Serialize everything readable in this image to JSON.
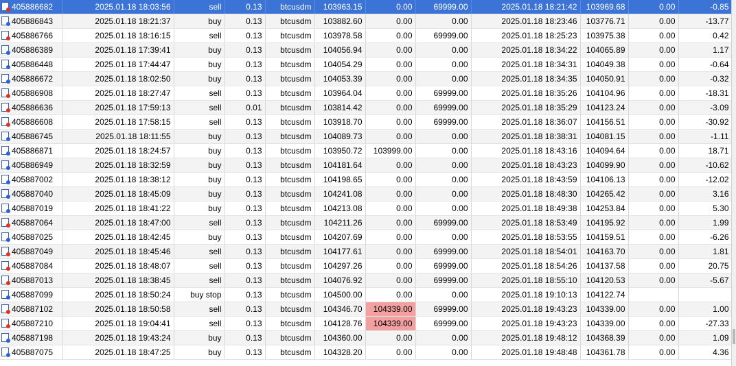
{
  "orders": [
    {
      "ticket": "405886682",
      "open_time": "2025.01.18 18:03:56",
      "type": "sell",
      "volume": "0.13",
      "symbol": "btcusdm",
      "price": "103963.15",
      "sl": "0.00",
      "tp": "69999.00",
      "close_time": "2025.01.18 18:21:42",
      "close_price": "103969.68",
      "swap": "0.00",
      "profit": "-0.85",
      "selected": true
    },
    {
      "ticket": "405886843",
      "open_time": "2025.01.18 18:21:37",
      "type": "buy",
      "volume": "0.13",
      "symbol": "btcusdm",
      "price": "103882.60",
      "sl": "0.00",
      "tp": "0.00",
      "close_time": "2025.01.18 18:23:46",
      "close_price": "103776.71",
      "swap": "0.00",
      "profit": "-13.77"
    },
    {
      "ticket": "405886766",
      "open_time": "2025.01.18 18:16:15",
      "type": "sell",
      "volume": "0.13",
      "symbol": "btcusdm",
      "price": "103978.58",
      "sl": "0.00",
      "tp": "69999.00",
      "close_time": "2025.01.18 18:25:23",
      "close_price": "103975.38",
      "swap": "0.00",
      "profit": "0.42"
    },
    {
      "ticket": "405886389",
      "open_time": "2025.01.18 17:39:41",
      "type": "buy",
      "volume": "0.13",
      "symbol": "btcusdm",
      "price": "104056.94",
      "sl": "0.00",
      "tp": "0.00",
      "close_time": "2025.01.18 18:34:22",
      "close_price": "104065.89",
      "swap": "0.00",
      "profit": "1.17"
    },
    {
      "ticket": "405886448",
      "open_time": "2025.01.18 17:44:47",
      "type": "buy",
      "volume": "0.13",
      "symbol": "btcusdm",
      "price": "104054.29",
      "sl": "0.00",
      "tp": "0.00",
      "close_time": "2025.01.18 18:34:31",
      "close_price": "104049.38",
      "swap": "0.00",
      "profit": "-0.64"
    },
    {
      "ticket": "405886672",
      "open_time": "2025.01.18 18:02:50",
      "type": "buy",
      "volume": "0.13",
      "symbol": "btcusdm",
      "price": "104053.39",
      "sl": "0.00",
      "tp": "0.00",
      "close_time": "2025.01.18 18:34:35",
      "close_price": "104050.91",
      "swap": "0.00",
      "profit": "-0.32"
    },
    {
      "ticket": "405886908",
      "open_time": "2025.01.18 18:27:47",
      "type": "sell",
      "volume": "0.13",
      "symbol": "btcusdm",
      "price": "103964.04",
      "sl": "0.00",
      "tp": "69999.00",
      "close_time": "2025.01.18 18:35:26",
      "close_price": "104104.96",
      "swap": "0.00",
      "profit": "-18.31"
    },
    {
      "ticket": "405886636",
      "open_time": "2025.01.18 17:59:13",
      "type": "sell",
      "volume": "0.01",
      "symbol": "btcusdm",
      "price": "103814.42",
      "sl": "0.00",
      "tp": "69999.00",
      "close_time": "2025.01.18 18:35:29",
      "close_price": "104123.24",
      "swap": "0.00",
      "profit": "-3.09"
    },
    {
      "ticket": "405886608",
      "open_time": "2025.01.18 17:58:15",
      "type": "sell",
      "volume": "0.13",
      "symbol": "btcusdm",
      "price": "103918.70",
      "sl": "0.00",
      "tp": "69999.00",
      "close_time": "2025.01.18 18:36:07",
      "close_price": "104156.51",
      "swap": "0.00",
      "profit": "-30.92"
    },
    {
      "ticket": "405886745",
      "open_time": "2025.01.18 18:11:55",
      "type": "buy",
      "volume": "0.13",
      "symbol": "btcusdm",
      "price": "104089.73",
      "sl": "0.00",
      "tp": "0.00",
      "close_time": "2025.01.18 18:38:31",
      "close_price": "104081.15",
      "swap": "0.00",
      "profit": "-1.11"
    },
    {
      "ticket": "405886871",
      "open_time": "2025.01.18 18:24:57",
      "type": "buy",
      "volume": "0.13",
      "symbol": "btcusdm",
      "price": "103950.72",
      "sl": "103999.00",
      "tp": "0.00",
      "close_time": "2025.01.18 18:43:16",
      "close_price": "104094.64",
      "swap": "0.00",
      "profit": "18.71"
    },
    {
      "ticket": "405886949",
      "open_time": "2025.01.18 18:32:59",
      "type": "buy",
      "volume": "0.13",
      "symbol": "btcusdm",
      "price": "104181.64",
      "sl": "0.00",
      "tp": "0.00",
      "close_time": "2025.01.18 18:43:23",
      "close_price": "104099.90",
      "swap": "0.00",
      "profit": "-10.62"
    },
    {
      "ticket": "405887002",
      "open_time": "2025.01.18 18:38:12",
      "type": "buy",
      "volume": "0.13",
      "symbol": "btcusdm",
      "price": "104198.65",
      "sl": "0.00",
      "tp": "0.00",
      "close_time": "2025.01.18 18:43:59",
      "close_price": "104106.13",
      "swap": "0.00",
      "profit": "-12.02"
    },
    {
      "ticket": "405887040",
      "open_time": "2025.01.18 18:45:09",
      "type": "buy",
      "volume": "0.13",
      "symbol": "btcusdm",
      "price": "104241.08",
      "sl": "0.00",
      "tp": "0.00",
      "close_time": "2025.01.18 18:48:30",
      "close_price": "104265.42",
      "swap": "0.00",
      "profit": "3.16"
    },
    {
      "ticket": "405887019",
      "open_time": "2025.01.18 18:41:22",
      "type": "buy",
      "volume": "0.13",
      "symbol": "btcusdm",
      "price": "104213.08",
      "sl": "0.00",
      "tp": "0.00",
      "close_time": "2025.01.18 18:49:38",
      "close_price": "104253.84",
      "swap": "0.00",
      "profit": "5.30"
    },
    {
      "ticket": "405887064",
      "open_time": "2025.01.18 18:47:00",
      "type": "sell",
      "volume": "0.13",
      "symbol": "btcusdm",
      "price": "104211.26",
      "sl": "0.00",
      "tp": "69999.00",
      "close_time": "2025.01.18 18:53:49",
      "close_price": "104195.92",
      "swap": "0.00",
      "profit": "1.99"
    },
    {
      "ticket": "405887025",
      "open_time": "2025.01.18 18:42:45",
      "type": "buy",
      "volume": "0.13",
      "symbol": "btcusdm",
      "price": "104207.69",
      "sl": "0.00",
      "tp": "0.00",
      "close_time": "2025.01.18 18:53:55",
      "close_price": "104159.51",
      "swap": "0.00",
      "profit": "-6.26"
    },
    {
      "ticket": "405887049",
      "open_time": "2025.01.18 18:45:46",
      "type": "sell",
      "volume": "0.13",
      "symbol": "btcusdm",
      "price": "104177.61",
      "sl": "0.00",
      "tp": "69999.00",
      "close_time": "2025.01.18 18:54:01",
      "close_price": "104163.70",
      "swap": "0.00",
      "profit": "1.81"
    },
    {
      "ticket": "405887084",
      "open_time": "2025.01.18 18:48:07",
      "type": "sell",
      "volume": "0.13",
      "symbol": "btcusdm",
      "price": "104297.26",
      "sl": "0.00",
      "tp": "69999.00",
      "close_time": "2025.01.18 18:54:26",
      "close_price": "104137.58",
      "swap": "0.00",
      "profit": "20.75"
    },
    {
      "ticket": "405887013",
      "open_time": "2025.01.18 18:38:45",
      "type": "sell",
      "volume": "0.13",
      "symbol": "btcusdm",
      "price": "104076.92",
      "sl": "0.00",
      "tp": "69999.00",
      "close_time": "2025.01.18 18:55:10",
      "close_price": "104120.53",
      "swap": "0.00",
      "profit": "-5.67"
    },
    {
      "ticket": "405887099",
      "open_time": "2025.01.18 18:50:24",
      "type": "buy stop",
      "volume": "0.13",
      "symbol": "btcusdm",
      "price": "104500.00",
      "sl": "0.00",
      "tp": "0.00",
      "close_time": "2025.01.18 19:10:13",
      "close_price": "104122.74",
      "swap": "",
      "profit": ""
    },
    {
      "ticket": "405887102",
      "open_time": "2025.01.18 18:50:58",
      "type": "sell",
      "volume": "0.13",
      "symbol": "btcusdm",
      "price": "104346.70",
      "sl": "104339.00",
      "tp": "69999.00",
      "close_time": "2025.01.18 19:43:23",
      "close_price": "104339.00",
      "swap": "0.00",
      "profit": "1.00",
      "sl_highlight": true
    },
    {
      "ticket": "405887210",
      "open_time": "2025.01.18 19:04:41",
      "type": "sell",
      "volume": "0.13",
      "symbol": "btcusdm",
      "price": "104128.76",
      "sl": "104339.00",
      "tp": "69999.00",
      "close_time": "2025.01.18 19:43:23",
      "close_price": "104339.00",
      "swap": "0.00",
      "profit": "-27.33",
      "sl_highlight": true
    },
    {
      "ticket": "405887198",
      "open_time": "2025.01.18 19:43:24",
      "type": "buy",
      "volume": "0.13",
      "symbol": "btcusdm",
      "price": "104360.00",
      "sl": "0.00",
      "tp": "0.00",
      "close_time": "2025.01.18 19:48:12",
      "close_price": "104368.39",
      "swap": "0.00",
      "profit": "1.09"
    },
    {
      "ticket": "405887075",
      "open_time": "2025.01.18 18:47:25",
      "type": "buy",
      "volume": "0.13",
      "symbol": "btcusdm",
      "price": "104328.20",
      "sl": "0.00",
      "tp": "0.00",
      "close_time": "2025.01.18 19:48:48",
      "close_price": "104361.78",
      "swap": "0.00",
      "profit": "4.36"
    }
  ]
}
